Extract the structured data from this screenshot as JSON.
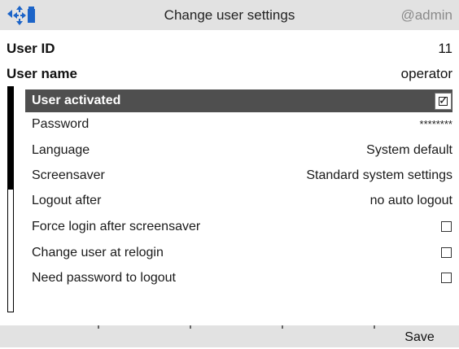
{
  "titlebar": {
    "title": "Change user settings",
    "current_user": "@admin",
    "icons": [
      "left-arrow-icon",
      "navigation-icon",
      "battery-icon"
    ],
    "accent_color": "#1c64c8"
  },
  "header_rows": [
    {
      "label": "User ID",
      "value": "11"
    },
    {
      "label": "User name",
      "value": "operator"
    }
  ],
  "settings": [
    {
      "label": "User activated",
      "checked": true,
      "selected": true
    },
    {
      "label": "Password",
      "value": "********"
    },
    {
      "label": "Language",
      "value": "System default"
    },
    {
      "label": "Screensaver",
      "value": "Standard system settings"
    },
    {
      "label": "Logout after",
      "value": "no auto logout"
    },
    {
      "label": "Force login after screensaver",
      "checked": false
    },
    {
      "label": "Change user at relogin",
      "checked": false
    },
    {
      "label": "Need password to logout",
      "checked": false
    }
  ],
  "scroll": {
    "position": 0.0,
    "visible_fraction": 0.45
  },
  "softkeys": [
    "",
    "",
    "",
    "",
    "Save"
  ],
  "checkmark_glyph": "✓"
}
